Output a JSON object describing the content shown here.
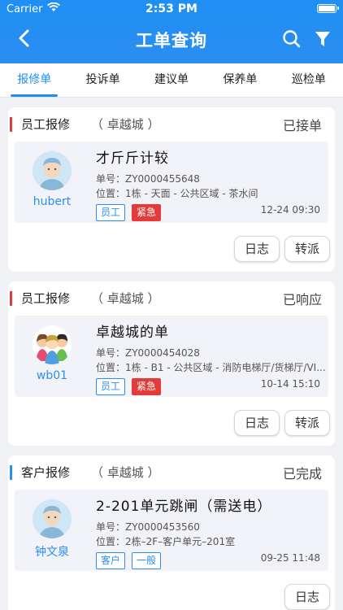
{
  "status": {
    "carrier": "Carrier",
    "time": "2:53 PM"
  },
  "nav": {
    "title": "工单查询"
  },
  "tabs": [
    "报修单",
    "投诉单",
    "建议单",
    "保养单",
    "巡检单"
  ],
  "orders": [
    {
      "type": "员工报修",
      "project": "（ 卓越城 ）",
      "state": "已接单",
      "type_color": "#e03c3c",
      "user": "hubert",
      "avatar": "person-avatar-icon",
      "title": "才斤斤计较",
      "number": "单号：ZY0000455648",
      "location": "位置：1栋 - 天面 - 公共区域 - 茶水间",
      "tags": [
        "员工",
        "紧急"
      ],
      "time": "12-24 09:30",
      "buttons": [
        "日志",
        "转派"
      ]
    },
    {
      "type": "员工报修",
      "project": "（ 卓越城 ）",
      "state": "已响应",
      "type_color": "#e03c3c",
      "user": "wb01",
      "avatar": "cartoon-group-avatar",
      "title": "卓越城的单",
      "number": "单号：ZY0000454028",
      "location": "位置：1栋 - B1 - 公共区域 - 消防电梯厅/货梯厅/VI...",
      "tags": [
        "员工",
        "紧急"
      ],
      "time": "10-14 15:10",
      "buttons": [
        "日志",
        "转派"
      ]
    },
    {
      "type": "客户报修",
      "project": "（ 卓越城 ）",
      "state": "已完成",
      "type_color": "#2b8ef0",
      "user": "钟文泉",
      "avatar": "person-avatar-icon",
      "title": "2-201单元跳闸（需送电）",
      "number": "单号：ZY0000453560",
      "location": "位置：2栋–2F–客户单元–201室",
      "tags": [
        "客户",
        "一般"
      ],
      "time": "09-25 11:48",
      "buttons": [
        "日志"
      ]
    }
  ]
}
